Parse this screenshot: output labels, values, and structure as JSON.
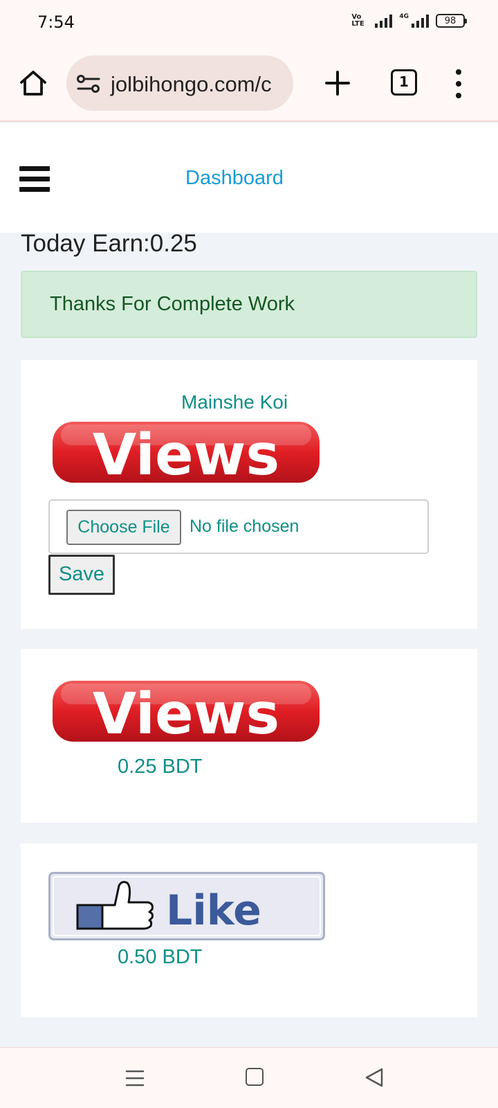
{
  "status_bar": {
    "time": "7:54",
    "volte_label": "Vo LTE",
    "network_label": "4G",
    "battery": "98"
  },
  "browser": {
    "url": "jolbihongo.com/c",
    "tab_count": "1",
    "icons": [
      "home-icon",
      "site-settings-icon",
      "new-tab-icon",
      "tab-switcher-icon",
      "overflow-menu-icon"
    ]
  },
  "site_header": {
    "menu_icon": "hamburger-icon",
    "dashboard_link": "Dashboard"
  },
  "summary": {
    "today_earn": "Today Earn:0.25"
  },
  "alert": {
    "message": "Thanks For Complete Work",
    "colors": {
      "background": "#d4edda",
      "text": "#155724"
    }
  },
  "task_card": {
    "title": "Mainshe Koi",
    "image_text": "Views",
    "file_button": "Choose File",
    "file_status": "No file chosen",
    "save_label": "Save"
  },
  "offers": [
    {
      "image_text": "Views",
      "price": "0.25 BDT"
    },
    {
      "image_text": "Like",
      "price": "0.50 BDT"
    }
  ],
  "nav_bar": {
    "icons": [
      "recents-icon",
      "home-square-icon",
      "back-icon"
    ]
  },
  "colors": {
    "accent_teal": "#0f8f86",
    "link_blue": "#1a9bd7",
    "views_red": "#e01e24",
    "like_blue": "#3b5a9a"
  }
}
